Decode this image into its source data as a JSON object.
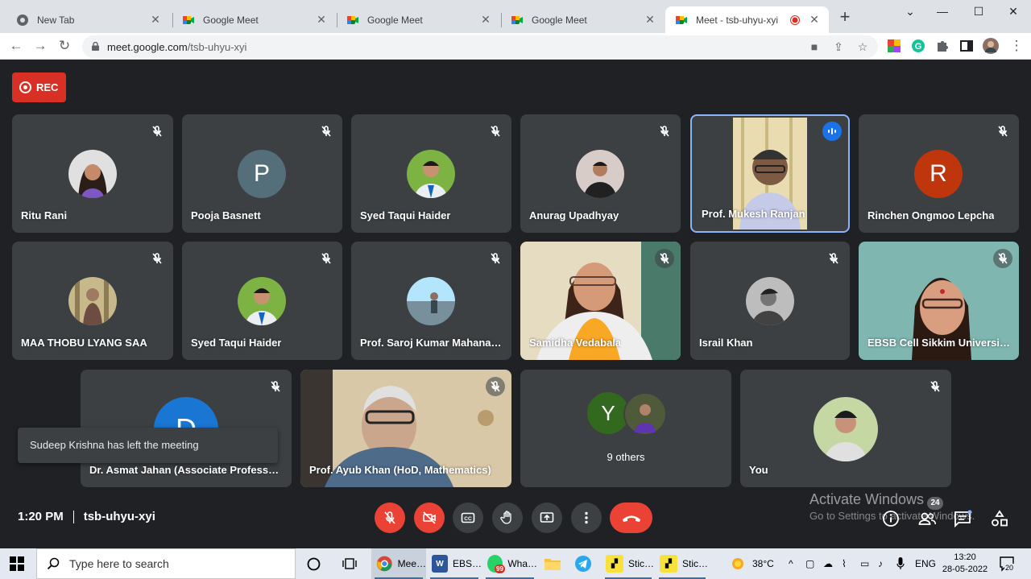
{
  "browser": {
    "tabs": [
      {
        "title": "New Tab",
        "favicon": "chrome-icon"
      },
      {
        "title": "Google Meet",
        "favicon": "meet-icon"
      },
      {
        "title": "Google Meet",
        "favicon": "meet-icon"
      },
      {
        "title": "Google Meet",
        "favicon": "meet-icon"
      },
      {
        "title": "Meet - tsb-uhyu-xyi",
        "favicon": "meet-icon",
        "active": true,
        "recording": true
      }
    ],
    "url_host": "meet.google.com",
    "url_path": "/tsb-uhyu-xyi"
  },
  "meet": {
    "rec_label": "REC",
    "participants": [
      {
        "name": "Ritu Rani",
        "kind": "photo",
        "muted": true
      },
      {
        "name": "Pooja Basnett",
        "kind": "letter",
        "letter": "P",
        "color": "#546e7a",
        "muted": true
      },
      {
        "name": "Syed Taqui Haider",
        "kind": "photo",
        "muted": true
      },
      {
        "name": "Anurag Upadhyay",
        "kind": "photo",
        "muted": true
      },
      {
        "name": "Prof. Mukesh Ranjan",
        "kind": "video",
        "speaking": true
      },
      {
        "name": "Rinchen Ongmoo Lepcha",
        "kind": "letter",
        "letter": "R",
        "color": "#bf360c",
        "muted": true
      },
      {
        "name": "MAA THOBU LYANG SAA",
        "kind": "photo",
        "muted": true
      },
      {
        "name": "Syed Taqui Haider",
        "kind": "photo",
        "muted": true
      },
      {
        "name": "Prof. Saroj Kumar Mahana…",
        "kind": "photo",
        "muted": true
      },
      {
        "name": "Samidha Vedabala",
        "kind": "video",
        "muted": true
      },
      {
        "name": "Israil Khan",
        "kind": "photo",
        "muted": true
      },
      {
        "name": "EBSB Cell Sikkim Universi…",
        "kind": "video",
        "muted": true
      },
      {
        "name": "Dr. Asmat Jahan (Associate Professo…",
        "kind": "letter",
        "letter": "D",
        "color": "#1976d2",
        "muted": true
      },
      {
        "name": "Prof. Ayub Khan (HoD, Mathematics)",
        "kind": "video",
        "muted": true
      },
      {
        "name": "9 others",
        "kind": "others",
        "letter": "Y",
        "color": "#33691e"
      },
      {
        "name": "You",
        "kind": "photo",
        "muted": true
      }
    ],
    "toast": "Sudeep Krishna has left the meeting",
    "time": "1:20 PM",
    "meeting_code": "tsb-uhyu-xyi",
    "people_count": "24",
    "activate_title": "Activate Windows",
    "activate_sub": "Go to Settings to activate Windows.",
    "controls": [
      "mic-off-button",
      "camera-off-button",
      "captions-button",
      "raise-hand-button",
      "present-button",
      "more-options-button",
      "leave-call-button"
    ]
  },
  "taskbar": {
    "search_placeholder": "Type here to search",
    "apps": [
      {
        "label": "Mee…",
        "icon": "chrome-icon"
      },
      {
        "label": "EBS…",
        "icon": "word-icon"
      },
      {
        "label": "Wha…",
        "icon": "whatsapp-icon",
        "badge": "99"
      },
      {
        "label": "Stic…",
        "icon": "sticky-notes-icon"
      },
      {
        "label": "Stic…",
        "icon": "sticky-notes-icon"
      }
    ],
    "temperature": "38°C",
    "language": "ENG",
    "time": "13:20",
    "date": "28-05-2022",
    "notifications": "20"
  }
}
